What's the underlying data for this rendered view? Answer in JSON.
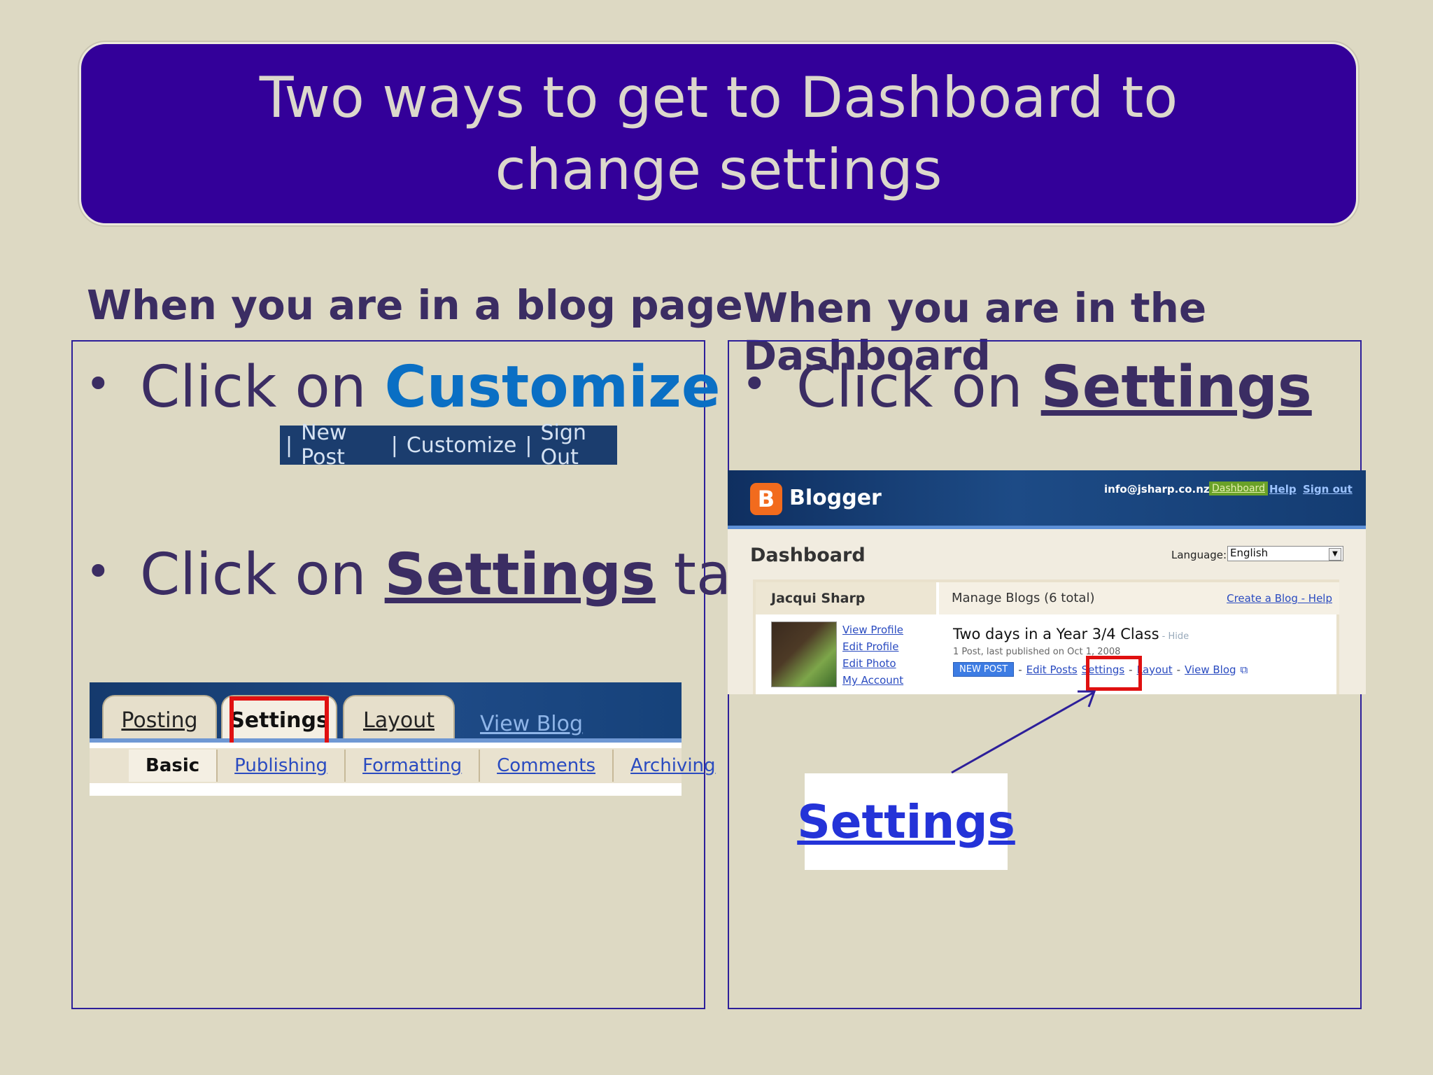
{
  "title": "Two ways to get to Dashboard to change settings",
  "left": {
    "heading": "When you are in a blog page",
    "bullet1_prefix": "Click on ",
    "bullet1_highlight": "Customize",
    "blog_nav": {
      "new_post": "New Post",
      "customize": "Customize",
      "sign_out": "Sign Out",
      "separator": "|"
    },
    "bullet2_prefix": "Click on ",
    "bullet2_highlight": "Settings",
    "bullet2_suffix": " tab",
    "tabs": {
      "posting": "Posting",
      "settings": "Settings",
      "layout": "Layout",
      "view_blog": "View Blog"
    },
    "subtabs": {
      "basic": "Basic",
      "publishing": "Publishing",
      "formatting": "Formatting",
      "comments": "Comments",
      "archiving": "Archiving"
    }
  },
  "right": {
    "heading": "When you are in the Dashboard",
    "bullet1_prefix": "Click on ",
    "bullet1_highlight": "Settings",
    "blogger": {
      "logo_letter": "B",
      "brand": "Blogger",
      "email": "info@jsharp.co.nz",
      "dashboard_link": "Dashboard",
      "help_link": "Help",
      "sign_out_link": "Sign out",
      "page_title": "Dashboard",
      "language_label": "Language:",
      "language_value": "English",
      "user_name": "Jacqui Sharp",
      "manage_blogs": "Manage Blogs (6 total)",
      "create_help": "Create a Blog - Help",
      "profile_links": [
        "View Profile",
        "Edit Profile",
        "Edit Photo",
        "My Account"
      ],
      "blog_title": "Two days in a Year 3/4 Class",
      "hide_link": " - Hide",
      "blog_meta": "1 Post, last published on Oct 1, 2008",
      "new_post_button": "NEW POST",
      "edit_posts": "Edit Posts",
      "settings": "Settings",
      "layout": "Layout",
      "view_blog": "View Blog"
    },
    "zoom_label": "Settings"
  },
  "colors": {
    "background": "#ddd9c3",
    "title_banner": "#330099",
    "text": "#3b2d63",
    "customize_blue": "#0a6fc4",
    "highlight_red": "#e01010"
  }
}
